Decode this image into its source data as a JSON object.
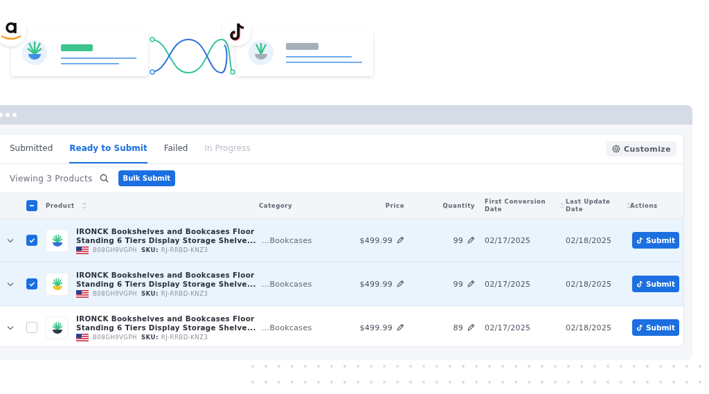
{
  "tabs": [
    {
      "label": "Submitted",
      "selected": false,
      "disabled": false
    },
    {
      "label": "Ready to Submit",
      "selected": true,
      "disabled": false
    },
    {
      "label": "Failed",
      "selected": false,
      "disabled": false
    },
    {
      "label": "In Progress",
      "selected": false,
      "disabled": true
    }
  ],
  "customize_button": "Customize",
  "toolbar": {
    "count": "Viewing 3 Products",
    "bulk_button": "Bulk Submit"
  },
  "table": {
    "select_all": {
      "indeterminate": true
    },
    "columns": [
      {
        "label": "Product",
        "sortable": true
      },
      {
        "label": "Category",
        "sortable": false
      },
      {
        "label": "Price",
        "sortable": false
      },
      {
        "label": "Quantity",
        "sortable": false
      },
      {
        "label": "First Conversion Date",
        "sortable": true
      },
      {
        "label": "Last Update Date",
        "sortable": true
      },
      {
        "label": "Actions",
        "sortable": false
      }
    ],
    "rows": [
      {
        "selected": true,
        "title_lines": [
          "IRONCK Bookshelves and Bookcases Floor",
          "Standing 6 Tiers Display Storage Shelve..."
        ],
        "asin": "B08GH9VGPH",
        "sku_label": "SKU:",
        "sku": "RJ-RRBD-KNZ3",
        "category": "...Bookcases",
        "price": "$499.99",
        "quantity": "99",
        "first_conversion": "02/17/2025",
        "last_update": "02/18/2025",
        "action": "Submit"
      },
      {
        "selected": true,
        "title_lines": [
          "IRONCK Bookshelves and Bookcases Floor",
          "Standing 6 Tiers Display Storage Shelve..."
        ],
        "asin": "B08GH9VGPH",
        "sku_label": "SKU:",
        "sku": "RJ-RRBD-KNZ3",
        "category": "...Bookcases",
        "price": "$499.99",
        "quantity": "99",
        "first_conversion": "02/17/2025",
        "last_update": "02/18/2025",
        "action": "Submit"
      },
      {
        "selected": false,
        "title_lines": [
          "IRONCK Bookshelves and Bookcases Floor",
          "Standing 6 Tiers Display Storage Shelve..."
        ],
        "asin": "B08GH9VGPH",
        "sku_label": "SKU:",
        "sku": "RJ-RRBD-KNZ3",
        "category": "...Bookcases",
        "price": "$499.99",
        "quantity": "89",
        "first_conversion": "02/17/2025",
        "last_update": "02/18/2025",
        "action": "Submit"
      }
    ]
  }
}
